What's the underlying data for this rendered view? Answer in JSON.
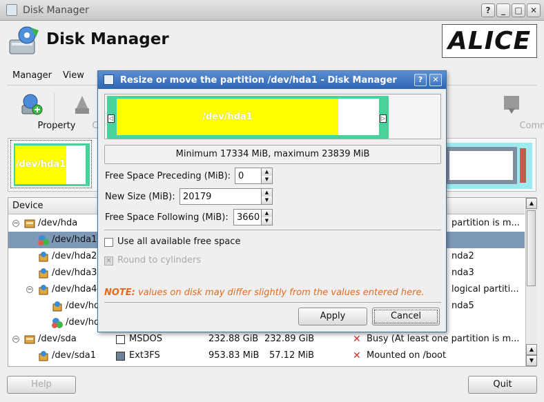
{
  "window": {
    "title": "Disk Manager"
  },
  "header": {
    "app_title": "Disk Manager",
    "logo_text": "ALICE"
  },
  "menu": {
    "items": [
      "Manager",
      "View"
    ]
  },
  "toolbar": {
    "property": "Property",
    "create": "Create",
    "commit": "Commit"
  },
  "partition_map": {
    "hda1_label": "/dev/hda1"
  },
  "tree": {
    "header": "Device",
    "rows": [
      {
        "device": "/dev/hda",
        "status": "partition is m..."
      },
      {
        "device": "/dev/hda1",
        "status": ""
      },
      {
        "device": "/dev/hda2",
        "status": "nda2"
      },
      {
        "device": "/dev/hda3",
        "status": "nda3"
      },
      {
        "device": "/dev/hda4",
        "status": "logical partiti..."
      },
      {
        "device": "/dev/hd",
        "status": "nda5"
      },
      {
        "device": "/dev/hd",
        "status": ""
      },
      {
        "device": "/dev/sda",
        "type": "MSDOS",
        "size": "232.88 GiB",
        "used": "232.89 GiB",
        "status": "Busy (At least one partition is m..."
      },
      {
        "device": "/dev/sda1",
        "type": "Ext3FS",
        "size": "953.83 MiB",
        "used": "57.12 MiB",
        "status": "Mounted on /boot"
      }
    ]
  },
  "buttons": {
    "help": "Help",
    "quit": "Quit"
  },
  "dialog": {
    "title": "Resize or move the partition /dev/hda1 - Disk Manager",
    "partition_label": "/dev/hda1",
    "minmax": "Minimum 17334 MiB, maximum 23839 MiB",
    "free_preceding_label": "Free Space Preceding (MiB):",
    "free_preceding_value": "0",
    "new_size_label": "New Size (MiB):",
    "new_size_value": "20179",
    "free_following_label": "Free Space Following (MiB):",
    "free_following_value": "3660",
    "use_all_label": "Use all available free space",
    "round_label": "Round to cylinders",
    "note_prefix": "NOTE:",
    "note_text": " values on disk may differ slightly from the values entered here.",
    "apply": "Apply",
    "cancel": "Cancel"
  },
  "colors": {
    "partition_fill": "#ffff00",
    "partition_bg": "#48d39c",
    "selection": "#7e98b8",
    "note": "#e06b1f",
    "dialog_title": "#2e66b5"
  }
}
